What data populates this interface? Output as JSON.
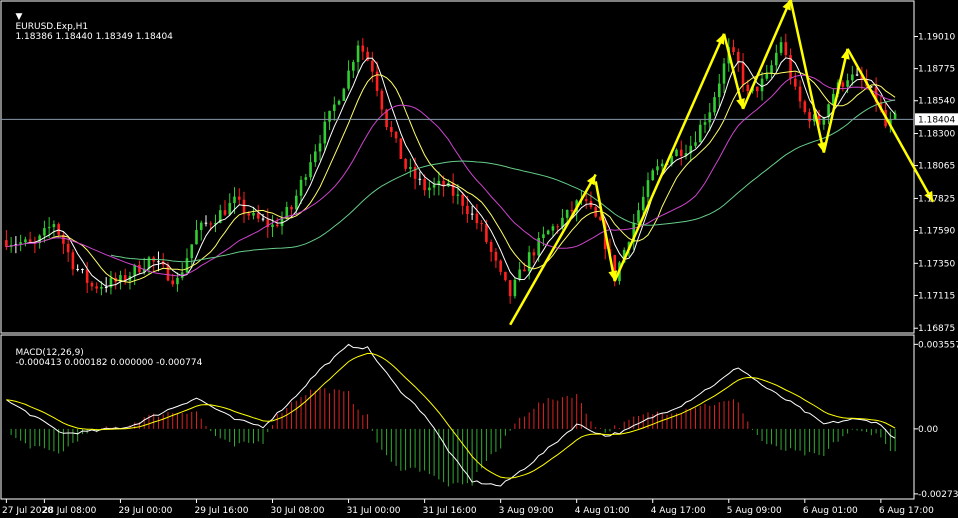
{
  "header": {
    "dropdown_icon": "triangle-down-icon",
    "symbol": "EURUSD.Exp,H1",
    "ohlc": "1.18386 1.18440 1.18349 1.18404"
  },
  "macd_header": {
    "name": "MACD(12,26,9)",
    "values": "-0.000413 0.000182 0.000000 -0.000774"
  },
  "price_axis": {
    "ticks": [
      "1.19010",
      "1.18775",
      "1.18540",
      "1.18300",
      "1.18065",
      "1.17825",
      "1.17590",
      "1.17350",
      "1.17115",
      "1.16875"
    ],
    "tick_values": [
      1.1901,
      1.18775,
      1.1854,
      1.183,
      1.18065,
      1.17825,
      1.1759,
      1.1735,
      1.17115,
      1.16875
    ],
    "current_label": "1.18404",
    "current_value": 1.18404,
    "range": [
      1.1684,
      1.1927
    ]
  },
  "macd_axis": {
    "ticks": [
      "0.003557",
      "0.00",
      "-0.002735"
    ],
    "tick_values": [
      0.003557,
      0.0,
      -0.002735
    ],
    "range": [
      -0.00295,
      0.00395
    ]
  },
  "time_axis": {
    "labels": [
      "27 Jul 2020",
      "28 Jul 08:00",
      "29 Jul 00:00",
      "29 Jul 16:00",
      "30 Jul 08:00",
      "31 Jul 00:00",
      "31 Jul 16:00",
      "3 Aug 09:00",
      "4 Aug 01:00",
      "4 Aug 17:00",
      "5 Aug 09:00",
      "6 Aug 01:00",
      "6 Aug 17:00"
    ],
    "label_bar_index": [
      0,
      8,
      24,
      40,
      56,
      72,
      88,
      104,
      120,
      136,
      152,
      168,
      184
    ]
  },
  "colors": {
    "background": "#000000",
    "bull": "#32cd32",
    "bear": "#ff2020",
    "doji": "#ffffff",
    "ma_fast": "#ffffff",
    "ma_mid": "#ffff66",
    "ma_slow": "#cc44cc",
    "ma_long": "#66cc88",
    "macd_line": "#ffffff",
    "signal_line": "#ffff00",
    "hist_pos": "#dd2222",
    "hist_neg": "#33aa33",
    "arrows": "#ffff00",
    "grid_axis": "#ffffff",
    "price_line": "#8899aa"
  },
  "chart_data": {
    "type": "candlestick",
    "timeframe": "H1",
    "anchors": [
      {
        "bar": 0,
        "price": 1.1752
      },
      {
        "bar": 6,
        "price": 1.1748
      },
      {
        "bar": 10,
        "price": 1.1765
      },
      {
        "bar": 14,
        "price": 1.1735
      },
      {
        "bar": 18,
        "price": 1.1718
      },
      {
        "bar": 24,
        "price": 1.1722
      },
      {
        "bar": 30,
        "price": 1.1738
      },
      {
        "bar": 36,
        "price": 1.1722
      },
      {
        "bar": 40,
        "price": 1.1758
      },
      {
        "bar": 48,
        "price": 1.178
      },
      {
        "bar": 52,
        "price": 1.1768
      },
      {
        "bar": 56,
        "price": 1.1762
      },
      {
        "bar": 60,
        "price": 1.1775
      },
      {
        "bar": 64,
        "price": 1.1812
      },
      {
        "bar": 68,
        "price": 1.1842
      },
      {
        "bar": 72,
        "price": 1.1875
      },
      {
        "bar": 74,
        "price": 1.1897
      },
      {
        "bar": 77,
        "price": 1.1878
      },
      {
        "bar": 80,
        "price": 1.1838
      },
      {
        "bar": 84,
        "price": 1.1805
      },
      {
        "bar": 88,
        "price": 1.179
      },
      {
        "bar": 92,
        "price": 1.1792
      },
      {
        "bar": 96,
        "price": 1.178
      },
      {
        "bar": 100,
        "price": 1.176
      },
      {
        "bar": 104,
        "price": 1.1725
      },
      {
        "bar": 106,
        "price": 1.1712
      },
      {
        "bar": 110,
        "price": 1.174
      },
      {
        "bar": 114,
        "price": 1.1758
      },
      {
        "bar": 118,
        "price": 1.177
      },
      {
        "bar": 121,
        "price": 1.1782
      },
      {
        "bar": 125,
        "price": 1.1762
      },
      {
        "bar": 128,
        "price": 1.1725
      },
      {
        "bar": 132,
        "price": 1.1765
      },
      {
        "bar": 136,
        "price": 1.18
      },
      {
        "bar": 140,
        "price": 1.1815
      },
      {
        "bar": 144,
        "price": 1.1822
      },
      {
        "bar": 148,
        "price": 1.1848
      },
      {
        "bar": 152,
        "price": 1.189
      },
      {
        "bar": 154,
        "price": 1.188
      },
      {
        "bar": 156,
        "price": 1.1858
      },
      {
        "bar": 160,
        "price": 1.187
      },
      {
        "bar": 163,
        "price": 1.1898
      },
      {
        "bar": 166,
        "price": 1.186
      },
      {
        "bar": 168,
        "price": 1.1845
      },
      {
        "bar": 171,
        "price": 1.1838
      },
      {
        "bar": 174,
        "price": 1.186
      },
      {
        "bar": 177,
        "price": 1.1872
      },
      {
        "bar": 180,
        "price": 1.1868
      },
      {
        "bar": 183,
        "price": 1.1855
      },
      {
        "bar": 185,
        "price": 1.1835
      },
      {
        "bar": 187,
        "price": 1.184
      }
    ],
    "arrows": [
      {
        "from": {
          "bar": 106,
          "price": 1.169
        },
        "to": {
          "bar": 124,
          "price": 1.18
        }
      },
      {
        "from": {
          "bar": 124,
          "price": 1.1795
        },
        "to": {
          "bar": 128,
          "price": 1.1722
        }
      },
      {
        "from": {
          "bar": 128,
          "price": 1.1722
        },
        "to": {
          "bar": 151,
          "price": 1.1903
        }
      },
      {
        "from": {
          "bar": 151,
          "price": 1.1903
        },
        "to": {
          "bar": 155,
          "price": 1.1848
        }
      },
      {
        "from": {
          "bar": 155,
          "price": 1.1848
        },
        "to": {
          "bar": 165,
          "price": 1.1928
        }
      },
      {
        "from": {
          "bar": 165,
          "price": 1.1928
        },
        "to": {
          "bar": 172,
          "price": 1.1816
        }
      },
      {
        "from": {
          "bar": 172,
          "price": 1.1816
        },
        "to": {
          "bar": 177,
          "price": 1.1892
        }
      },
      {
        "from": {
          "bar": 177,
          "price": 1.1892
        },
        "to": {
          "bar": 195,
          "price": 1.178
        }
      }
    ],
    "macd": {
      "anchors": [
        {
          "bar": 0,
          "value": 0.0012
        },
        {
          "bar": 6,
          "value": 0.0005
        },
        {
          "bar": 12,
          "value": -0.0002
        },
        {
          "bar": 18,
          "value": -0.0001
        },
        {
          "bar": 26,
          "value": 0.0001
        },
        {
          "bar": 34,
          "value": 0.0008
        },
        {
          "bar": 40,
          "value": 0.0013
        },
        {
          "bar": 48,
          "value": 0.0004
        },
        {
          "bar": 54,
          "value": 0.0001
        },
        {
          "bar": 60,
          "value": 0.0012
        },
        {
          "bar": 66,
          "value": 0.0025
        },
        {
          "bar": 72,
          "value": 0.0035
        },
        {
          "bar": 76,
          "value": 0.0034
        },
        {
          "bar": 82,
          "value": 0.0018
        },
        {
          "bar": 88,
          "value": 0.0006
        },
        {
          "bar": 94,
          "value": -0.0012
        },
        {
          "bar": 98,
          "value": -0.0022
        },
        {
          "bar": 104,
          "value": -0.0024
        },
        {
          "bar": 110,
          "value": -0.0015
        },
        {
          "bar": 116,
          "value": -0.0005
        },
        {
          "bar": 120,
          "value": 0.0002
        },
        {
          "bar": 126,
          "value": -0.0003
        },
        {
          "bar": 130,
          "value": -0.0001
        },
        {
          "bar": 136,
          "value": 0.0005
        },
        {
          "bar": 142,
          "value": 0.001
        },
        {
          "bar": 150,
          "value": 0.002
        },
        {
          "bar": 154,
          "value": 0.0026
        },
        {
          "bar": 160,
          "value": 0.0017
        },
        {
          "bar": 166,
          "value": 0.001
        },
        {
          "bar": 172,
          "value": 0.0002
        },
        {
          "bar": 178,
          "value": 0.0004
        },
        {
          "bar": 183,
          "value": 0.0003
        },
        {
          "bar": 187,
          "value": -0.0004
        }
      ],
      "signal_period": 9
    }
  }
}
